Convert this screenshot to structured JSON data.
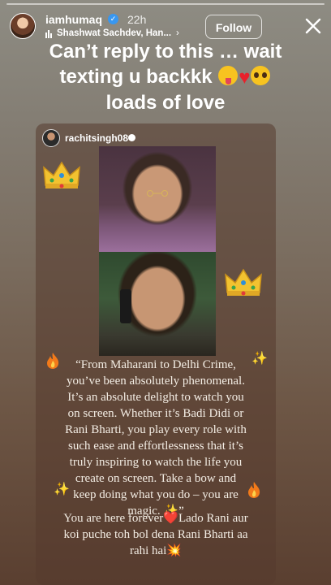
{
  "header": {
    "username": "iamhumaq",
    "time": "22h",
    "music_text": "Shashwat Sachdev, Han...",
    "chevron": "›",
    "follow_label": "Follow",
    "close_icon": "close-icon"
  },
  "headline": {
    "line1": "Can’t reply to this … wait",
    "line2": "texting u backkk",
    "line3": "loads of love"
  },
  "card": {
    "username": "rachitsingh08",
    "quote_lines": [
      "“From Maharani to Delhi Crime,",
      "you’ve been absolutely phenomenal.",
      "It’s an absolute delight to watch you",
      "on screen. Whether it’s Badi Didi or",
      "Rani Bharti, you play every role with",
      "such ease and effortlessness that it’s",
      "truly inspiring to watch the life you",
      "create on screen. Take a bow and",
      "keep doing what you do – you are",
      "magic. ✨”"
    ],
    "outro": {
      "line1_text": "You are here forever",
      "heart": "❤️",
      "line1_rest": "Lado Rani aur",
      "line2": "koi puche toh bol dena Rani Bharti aa",
      "line3": "rahi hai",
      "burst": "💥"
    }
  },
  "colors": {
    "accent_blue": "#3897f0",
    "heart_red": "#e8212b",
    "text_light": "#f3ede4"
  }
}
